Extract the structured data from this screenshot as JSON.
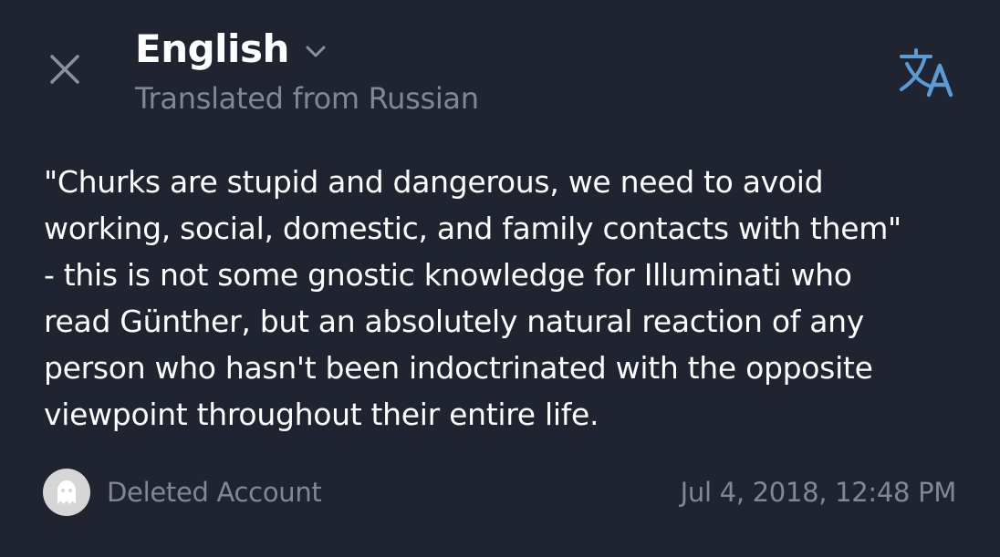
{
  "header": {
    "language": "English",
    "subtitle": "Translated from Russian"
  },
  "icons": {
    "close": "close-icon",
    "chevron": "chevron-down-icon",
    "translate": "translate-icon",
    "avatar": "ghost-icon"
  },
  "message": {
    "lines": [
      "\"Churks are stupid and dangerous, we need to avoid",
      "working, social, domestic, and family contacts with them\"",
      "- this is not some gnostic knowledge for Illuminati who",
      "read Günther, but an absolutely natural reaction of any",
      "person who hasn't been indoctrinated with the opposite",
      "viewpoint throughout their entire life."
    ],
    "author": "Deleted Account",
    "timestamp": "Jul 4, 2018, 12:48 PM"
  },
  "colors": {
    "background": "#1f2430",
    "accent": "#5b9bd5",
    "muted_text": "#7f8896",
    "text": "#ffffff"
  }
}
